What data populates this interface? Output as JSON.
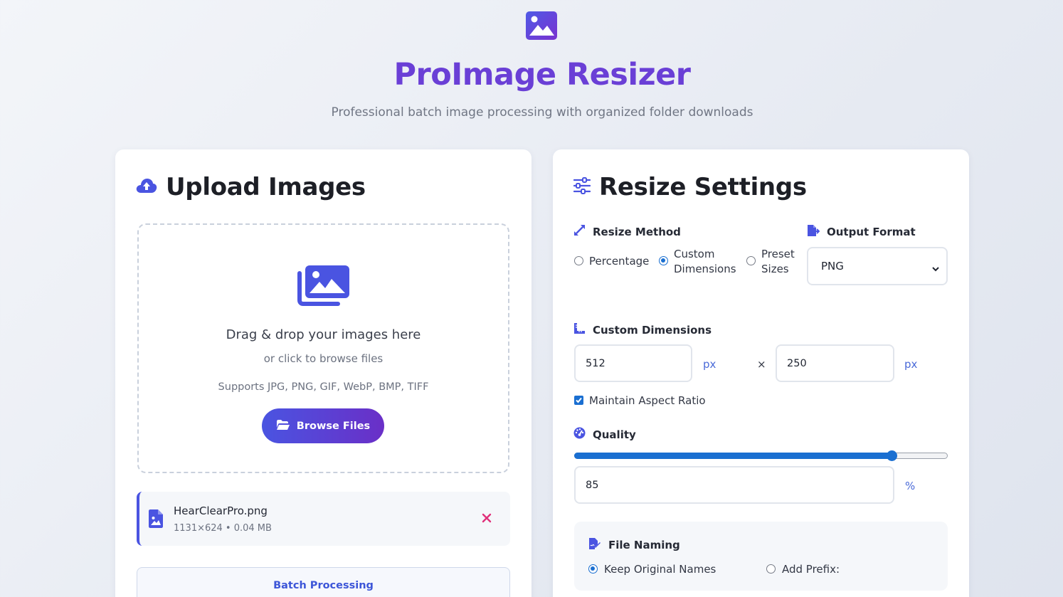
{
  "app": {
    "title": "ProImage Resizer",
    "subtitle": "Professional batch image processing with organized folder downloads",
    "logo_icon": "image-icon"
  },
  "colors": {
    "accent": "#4a54e1",
    "accent_purple": "#6a3fd6",
    "radio_blue": "#1a6fd1",
    "danger": "#e0307a"
  },
  "upload": {
    "title": "Upload Images",
    "title_icon": "cloud-upload-icon",
    "dropzone": {
      "icon": "images-icon",
      "title": "Drag & drop your images here",
      "subtitle": "or click to browse files",
      "supported": "Supports JPG, PNG, GIF, WebP, BMP, TIFF",
      "browse_label": "Browse Files",
      "browse_icon": "folder-open-icon"
    },
    "files": [
      {
        "name": "HearClearPro.png",
        "meta": "1131×624 • 0.04 MB",
        "icon": "file-image-icon",
        "remove_icon": "close-icon"
      }
    ],
    "batch_label": "Batch Processing"
  },
  "settings": {
    "title": "Resize Settings",
    "title_icon": "sliders-icon",
    "resize_method": {
      "label": "Resize Method",
      "icon": "expand-arrows-icon",
      "options": [
        {
          "label": "Percentage",
          "selected": false
        },
        {
          "label": "Custom Dimensions",
          "selected": true
        },
        {
          "label": "Preset Sizes",
          "selected": false
        }
      ]
    },
    "output_format": {
      "label": "Output Format",
      "icon": "file-export-icon",
      "value": "PNG"
    },
    "custom_dimensions": {
      "label": "Custom Dimensions",
      "icon": "ruler-icon",
      "width": "512",
      "height": "250",
      "unit": "px",
      "separator": "×"
    },
    "aspect_ratio": {
      "label": "Maintain Aspect Ratio",
      "checked": true
    },
    "quality": {
      "label": "Quality",
      "icon": "gauge-icon",
      "value": "85",
      "unit": "%",
      "level": 0.85
    },
    "file_naming": {
      "label": "File Naming",
      "icon": "file-signature-icon",
      "options": [
        {
          "label": "Keep Original Names",
          "selected": true
        },
        {
          "label": "Add Prefix:",
          "selected": false
        }
      ]
    }
  }
}
